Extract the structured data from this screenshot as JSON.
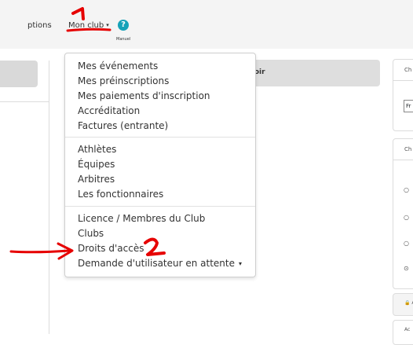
{
  "nav": {
    "options_label": "ptions",
    "monclub_label": "Mon club",
    "monclub_caret": "▾",
    "help_icon_glyph": "?",
    "help_label": "Manuel"
  },
  "main": {
    "center_header": "voir",
    "right_cards": [
      {
        "header": "Ch",
        "select_value": "Fr"
      },
      {
        "header": "Ch",
        "radios": [
          "○",
          "○",
          "○",
          "⊙"
        ]
      },
      {
        "text": "🔒 A"
      },
      {
        "text": "Ac"
      }
    ]
  },
  "dropdown": {
    "group1": [
      "Mes événements",
      "Mes préinscriptions",
      "Mes paiements d'inscription",
      "Accréditation",
      "Factures (entrante)"
    ],
    "group2": [
      "Athlètes",
      "Équipes",
      "Arbitres",
      "Les fonctionnaires"
    ],
    "group3": [
      "Licence / Membres du Club",
      "Clubs",
      "Droits d'accès",
      "Demande d'utilisateur en attente"
    ],
    "submenu_caret": "▾"
  },
  "annotations": {
    "label_1": "1",
    "label_2": "2",
    "color": "#e60000"
  }
}
